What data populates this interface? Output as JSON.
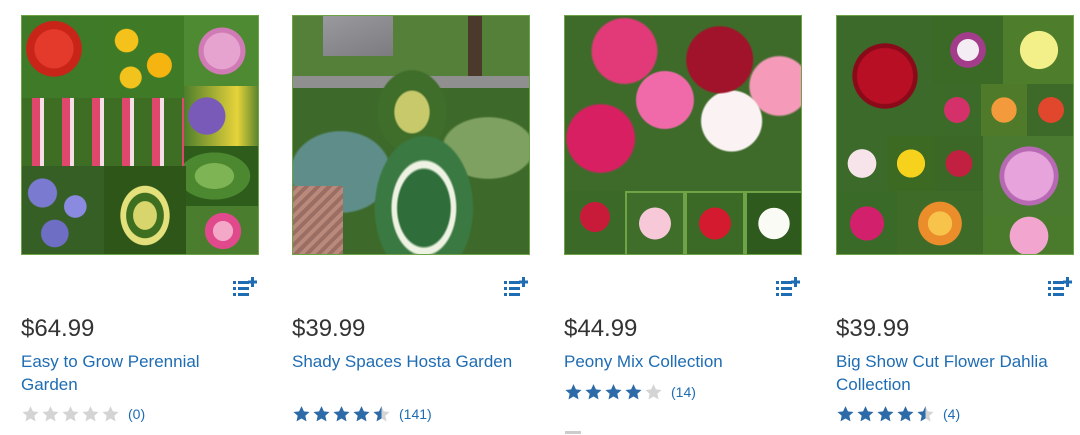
{
  "colors": {
    "link": "#1e6cb3",
    "price": "#333333",
    "star_filled": "#2d6aa8",
    "star_empty": "#d4d4d4",
    "image_border": "#6ea346"
  },
  "products": [
    {
      "price": "$64.99",
      "title": "Easy to Grow Perennial Garden",
      "rating": 0,
      "review_count": "(0)",
      "list_icon": "add-to-list-icon"
    },
    {
      "price": "$39.99",
      "title": "Shady Spaces Hosta Garden",
      "rating": 4.5,
      "review_count": "(141)",
      "list_icon": "add-to-list-icon"
    },
    {
      "price": "$44.99",
      "title": "Peony Mix Collection",
      "rating": 4,
      "review_count": "(14)",
      "list_icon": "add-to-list-icon"
    },
    {
      "price": "$39.99",
      "title": "Big Show Cut Flower Dahlia Collection",
      "rating": 4.5,
      "review_count": "(4)",
      "list_icon": "add-to-list-icon"
    }
  ]
}
